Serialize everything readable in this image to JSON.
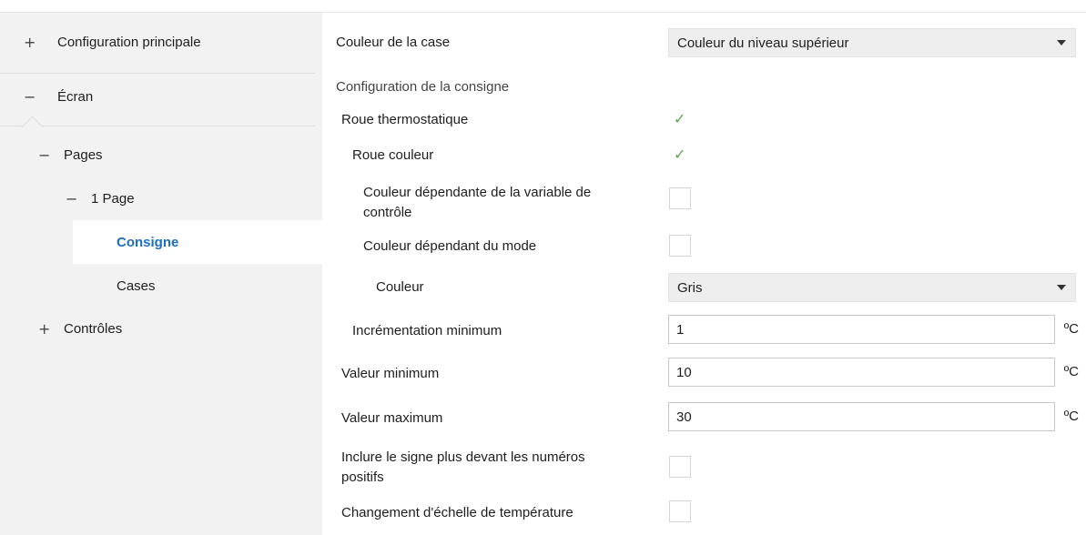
{
  "sidebar": {
    "items": [
      {
        "symbol": "+",
        "label": "Configuration principale"
      },
      {
        "symbol": "−",
        "label": "Écran"
      },
      {
        "symbol": "−",
        "label": "Pages"
      },
      {
        "symbol": "−",
        "label": "1 Page"
      },
      {
        "symbol": "",
        "label": "Consigne"
      },
      {
        "symbol": "",
        "label": "Cases"
      },
      {
        "symbol": "+",
        "label": "Contrôles"
      }
    ]
  },
  "main": {
    "box_color": {
      "label": "Couleur de la case",
      "value": "Couleur du niveau supérieur"
    },
    "section_title": "Configuration de la consigne",
    "thermo_wheel": {
      "label": "Roue thermostatique",
      "checked": true
    },
    "color_wheel": {
      "label": "Roue couleur",
      "checked": true
    },
    "color_dep_var": {
      "label_line1": "Couleur dépendante de la variable de",
      "label_line2": "contrôle",
      "checked": false
    },
    "color_dep_mode": {
      "label": "Couleur dépendant du mode",
      "checked": false
    },
    "color": {
      "label": "Couleur",
      "value": "Gris"
    },
    "min_increment": {
      "label": "Incrémentation minimum",
      "value": "1",
      "unit": "ºC"
    },
    "min_value": {
      "label": "Valeur minimum",
      "value": "10",
      "unit": "ºC"
    },
    "max_value": {
      "label": "Valeur maximum",
      "value": "30",
      "unit": "ºC"
    },
    "plus_sign": {
      "label_line1": "Inclure le signe plus devant les numéros",
      "label_line2": "positifs",
      "checked": false
    },
    "scale_change": {
      "label": "Changement d'échelle de température",
      "checked": false
    }
  },
  "icons": {
    "check": "checkmark-icon",
    "dropdown": "caret-down-icon"
  },
  "colors": {
    "accent": "#1b6ec2",
    "check": "#5aa84a",
    "sidebar_bg": "#f2f2f2"
  }
}
